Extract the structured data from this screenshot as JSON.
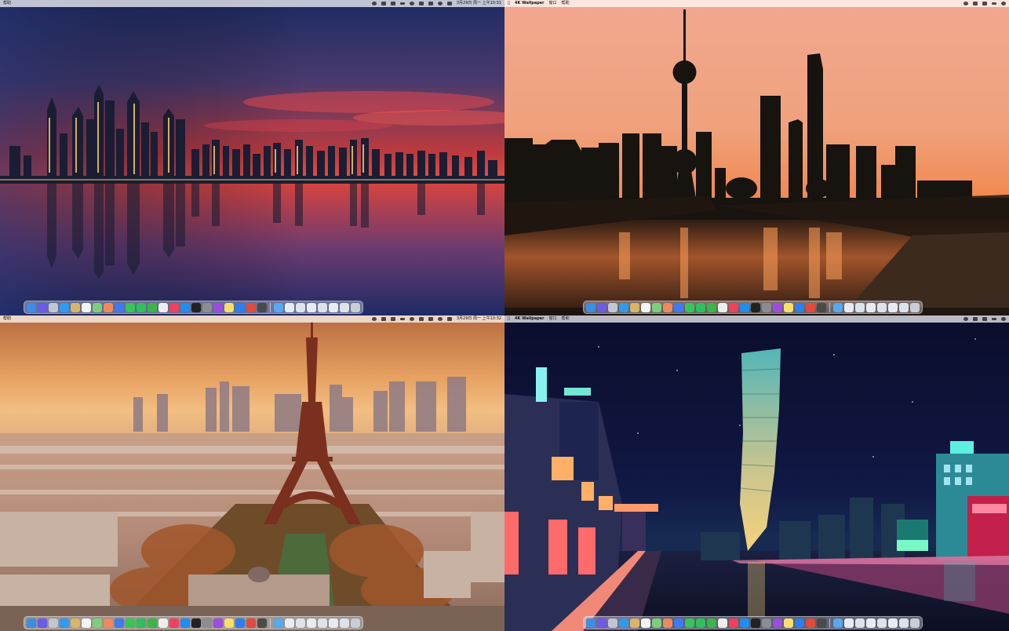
{
  "panels": {
    "top_left": {
      "menubar": {
        "left_items": [
          "帮助"
        ],
        "date_time": "3月29日 周一 上午10:31"
      }
    },
    "top_right": {
      "menubar": {
        "left_items": [
          "4K Wallpaper",
          "窗口",
          "帮助"
        ]
      }
    },
    "bottom_left": {
      "menubar": {
        "left_items": [
          "帮助"
        ],
        "date_time": "3月29日 周一 上午10:32"
      }
    },
    "bottom_right": {
      "menubar": {
        "left_items": [
          "4K Wallpaper",
          "窗口",
          "帮助"
        ]
      }
    }
  },
  "dock_apps": [
    {
      "name": "finder-icon",
      "color": "#3a8ee6"
    },
    {
      "name": "siri-icon",
      "color": "#6b5ce7"
    },
    {
      "name": "launchpad-icon",
      "color": "#c0c6d4"
    },
    {
      "name": "safari-icon",
      "color": "#2f9bf0"
    },
    {
      "name": "notes-yellow-icon",
      "color": "#d9b56a"
    },
    {
      "name": "calendar-icon",
      "color": "#f5f5f5"
    },
    {
      "name": "maps-icon",
      "color": "#7ccf7a"
    },
    {
      "name": "photos-icon",
      "color": "#f08a5d"
    },
    {
      "name": "mail-icon",
      "color": "#3d7bf5"
    },
    {
      "name": "messages-icon",
      "color": "#38c45a"
    },
    {
      "name": "facetime-icon",
      "color": "#2fbf5b"
    },
    {
      "name": "wechat-icon",
      "color": "#3bb54a"
    },
    {
      "name": "reminders-icon",
      "color": "#eeeeee"
    },
    {
      "name": "music-icon",
      "color": "#f2405c"
    },
    {
      "name": "appstore-icon",
      "color": "#1e8ef0"
    },
    {
      "name": "appletv-icon",
      "color": "#222222"
    },
    {
      "name": "settings-icon",
      "color": "#8a8d93"
    },
    {
      "name": "podcasts-icon",
      "color": "#9b4de0"
    },
    {
      "name": "notes-icon",
      "color": "#f7df6b"
    },
    {
      "name": "xcode-icon",
      "color": "#2b7ff0"
    },
    {
      "name": "chrome-icon",
      "color": "#e24b3b"
    },
    {
      "name": "terminal-icon",
      "color": "#4a4a4a"
    }
  ],
  "dock_folders": [
    {
      "name": "downloads-folder-icon",
      "color": "#58a8f0"
    },
    {
      "name": "window-thumb-icon",
      "color": "#e8ecf2"
    },
    {
      "name": "window-thumb-icon",
      "color": "#dde3ea"
    },
    {
      "name": "window-thumb-icon",
      "color": "#e8ecf2"
    },
    {
      "name": "window-thumb-icon",
      "color": "#dde3ea"
    },
    {
      "name": "window-thumb-icon",
      "color": "#e8ecf2"
    },
    {
      "name": "window-thumb-icon",
      "color": "#dde3ea"
    },
    {
      "name": "trash-icon",
      "color": "#c9ced6"
    }
  ]
}
